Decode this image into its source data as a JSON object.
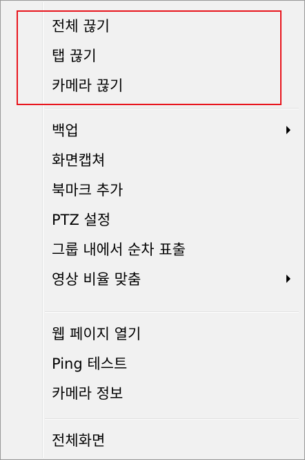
{
  "menu": {
    "groups": [
      {
        "items": [
          {
            "label": "전체 끊기",
            "has_submenu": false
          },
          {
            "label": "탭 끊기",
            "has_submenu": false
          },
          {
            "label": "카메라 끊기",
            "has_submenu": false
          }
        ]
      },
      {
        "items": [
          {
            "label": "백업",
            "has_submenu": true
          },
          {
            "label": "화면캡쳐",
            "has_submenu": false
          },
          {
            "label": "북마크 추가",
            "has_submenu": false
          },
          {
            "label": "PTZ 설정",
            "has_submenu": false
          },
          {
            "label": "그룹 내에서 순차 표출",
            "has_submenu": false
          },
          {
            "label": "영상 비율 맞춤",
            "has_submenu": true
          }
        ]
      },
      {
        "items": [
          {
            "label": "웹 페이지 열기",
            "has_submenu": false
          },
          {
            "label": "Ping 테스트",
            "has_submenu": false
          },
          {
            "label": "카메라 정보",
            "has_submenu": false
          }
        ]
      },
      {
        "items": [
          {
            "label": "전체화면",
            "has_submenu": false
          }
        ]
      }
    ],
    "highlight_color": "#e8141c"
  }
}
